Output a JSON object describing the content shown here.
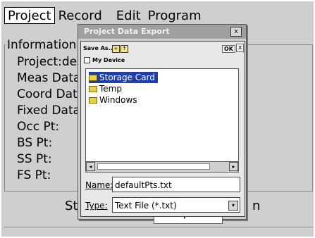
{
  "menubar": {
    "items": [
      "Project",
      "Record",
      "Edit",
      "Program"
    ]
  },
  "info": {
    "title": "Information",
    "rows": [
      "Project:de",
      "Meas Data",
      "Coord Dat",
      "Fixed Data",
      "Occ Pt:",
      "BS Pt:",
      "SS Pt:",
      "FS Pt:"
    ]
  },
  "bottom": {
    "left_text": "Sta",
    "right_text": "n",
    "export_label": "Export"
  },
  "export_dialog": {
    "title": "Project Data Export",
    "close_label": "x"
  },
  "save_as": {
    "title": "Save As...",
    "ok_label": "OK",
    "close_label": "x",
    "location": "My Device",
    "files": [
      {
        "name": "Storage Card",
        "selected": true
      },
      {
        "name": "Temp",
        "selected": false
      },
      {
        "name": "Windows",
        "selected": false
      }
    ],
    "name_label": "Name:",
    "name_value": "defaultPts.txt",
    "type_label": "Type:",
    "type_value": "Text File (*.txt)",
    "scroll_left": "◂",
    "scroll_right": "▸",
    "drop_arrow": "▾"
  },
  "icons": {
    "new_folder": "new-folder-icon",
    "up_folder": "up-folder-icon",
    "device": "device-icon",
    "folder": "folder-icon"
  },
  "colors": {
    "selection": "#1f3ea8",
    "folder": "#e6d24a"
  }
}
